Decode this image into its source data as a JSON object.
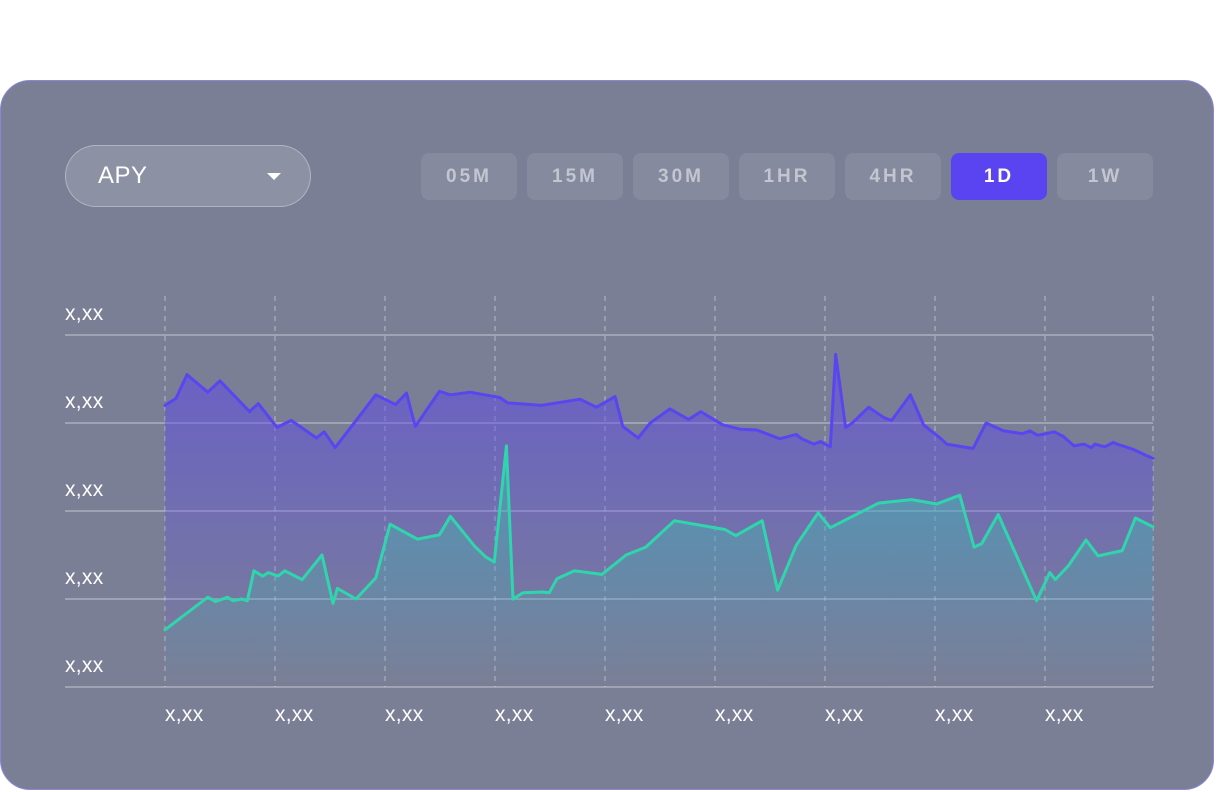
{
  "selector": {
    "label": "APY"
  },
  "timeframes": [
    {
      "label": "05M",
      "active": false
    },
    {
      "label": "15M",
      "active": false
    },
    {
      "label": "30M",
      "active": false
    },
    {
      "label": "1HR",
      "active": false
    },
    {
      "label": "4HR",
      "active": false
    },
    {
      "label": "1D",
      "active": true
    },
    {
      "label": "1W",
      "active": false
    }
  ],
  "colors": {
    "card_bg": "#7b7f96",
    "accent": "#5a43f0",
    "series_purple": "#5b45f0",
    "series_green": "#2fd6ac"
  },
  "chart_data": {
    "type": "area",
    "ytick_labels": [
      "x,xx",
      "x,xx",
      "x,xx",
      "x,xx",
      "x,xx"
    ],
    "xtick_labels": [
      "x,xx",
      "x,xx",
      "x,xx",
      "x,xx",
      "x,xx",
      "x,xx",
      "x,xx",
      "x,xx",
      "x,xx"
    ],
    "ylim": [
      0,
      4
    ],
    "xlim": [
      0,
      9
    ],
    "grid": true,
    "series": [
      {
        "color": "#5b45f0",
        "x": [
          0,
          0.1,
          0.2,
          0.39,
          0.5,
          0.77,
          0.85,
          1.02,
          1.15,
          1.38,
          1.45,
          1.55,
          1.92,
          2.1,
          2.2,
          2.28,
          2.5,
          2.6,
          2.78,
          3.05,
          3.12,
          3.43,
          3.78,
          3.93,
          4.1,
          4.17,
          4.31,
          4.42,
          4.6,
          4.77,
          4.88,
          5.08,
          5.24,
          5.39,
          5.6,
          5.75,
          5.8,
          5.91,
          5.97,
          6.06,
          6.11,
          6.2,
          6.26,
          6.41,
          6.55,
          6.62,
          6.79,
          6.91,
          7.07,
          7.12,
          7.36,
          7.48,
          7.64,
          7.81,
          7.88,
          7.95,
          8.1,
          8.18,
          8.28,
          8.37,
          8.44,
          8.47,
          8.56,
          8.64,
          8.67,
          8.75,
          8.82,
          8.89,
          8.94,
          9.0
        ],
        "y": [
          3.2,
          3.28,
          3.55,
          3.35,
          3.48,
          3.13,
          3.22,
          2.95,
          3.03,
          2.83,
          2.9,
          2.72,
          3.32,
          3.21,
          3.34,
          2.96,
          3.36,
          3.32,
          3.35,
          3.29,
          3.23,
          3.2,
          3.27,
          3.18,
          3.3,
          2.96,
          2.83,
          3.0,
          3.16,
          3.04,
          3.13,
          2.98,
          2.93,
          2.92,
          2.82,
          2.87,
          2.82,
          2.76,
          2.79,
          2.73,
          3.78,
          2.95,
          3.0,
          3.18,
          3.06,
          3.03,
          3.32,
          2.98,
          2.82,
          2.76,
          2.71,
          3.0,
          2.91,
          2.88,
          2.91,
          2.86,
          2.9,
          2.85,
          2.74,
          2.76,
          2.72,
          2.76,
          2.73,
          2.78,
          2.76,
          2.73,
          2.7,
          2.66,
          2.63,
          2.6
        ]
      },
      {
        "color": "#2fd6ac",
        "x": [
          0,
          0.39,
          0.46,
          0.57,
          0.62,
          0.7,
          0.75,
          0.81,
          0.89,
          0.94,
          1.03,
          1.09,
          1.25,
          1.43,
          1.53,
          1.57,
          1.74,
          1.92,
          2.05,
          2.3,
          2.5,
          2.6,
          2.82,
          2.92,
          3.0,
          3.11,
          3.17,
          3.26,
          3.44,
          3.5,
          3.57,
          3.73,
          3.98,
          4.2,
          4.38,
          4.64,
          5.1,
          5.2,
          5.44,
          5.58,
          5.75,
          5.95,
          6.06,
          6.5,
          6.8,
          7.03,
          7.24,
          7.37,
          7.44,
          7.59,
          7.94,
          8.06,
          8.11,
          8.23,
          8.39,
          8.5,
          8.72,
          8.84,
          9.0
        ],
        "y": [
          0.65,
          1.02,
          0.97,
          1.02,
          0.98,
          1.0,
          0.98,
          1.32,
          1.26,
          1.3,
          1.26,
          1.32,
          1.22,
          1.5,
          0.95,
          1.12,
          1.0,
          1.24,
          1.85,
          1.68,
          1.73,
          1.94,
          1.6,
          1.48,
          1.42,
          2.74,
          1.0,
          1.07,
          1.08,
          1.07,
          1.23,
          1.32,
          1.28,
          1.5,
          1.59,
          1.89,
          1.79,
          1.72,
          1.89,
          1.1,
          1.61,
          1.98,
          1.81,
          2.09,
          2.13,
          2.08,
          2.18,
          1.59,
          1.63,
          1.96,
          0.98,
          1.3,
          1.22,
          1.38,
          1.67,
          1.49,
          1.55,
          1.92,
          1.82
        ]
      }
    ]
  }
}
